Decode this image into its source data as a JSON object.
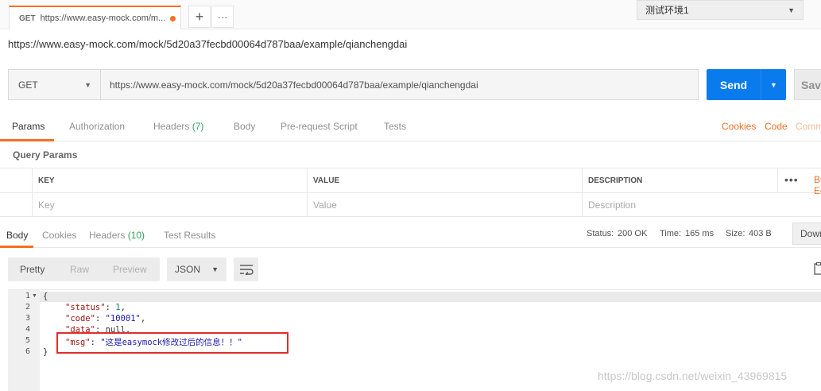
{
  "tab": {
    "method": "GET",
    "title": "https://www.easy-mock.com/m..."
  },
  "tab_buttons": {
    "add": "+",
    "more": "···"
  },
  "environment": {
    "selected": "测试环境1"
  },
  "request": {
    "title_url": "https://www.easy-mock.com/mock/5d20a37fecbd00064d787baa/example/qianchengdai",
    "method": "GET",
    "url": "https://www.easy-mock.com/mock/5d20a37fecbd00064d787baa/example/qianchengdai",
    "send_label": "Send",
    "save_label": "Save"
  },
  "request_tabs": {
    "params": "Params",
    "authorization": "Authorization",
    "headers": "Headers",
    "headers_count": "(7)",
    "body": "Body",
    "prerequest": "Pre-request Script",
    "tests": "Tests",
    "cookies": "Cookies",
    "code": "Code",
    "comments": "Comments"
  },
  "query_params": {
    "title": "Query Params",
    "columns": {
      "key": "KEY",
      "value": "VALUE",
      "description": "DESCRIPTION"
    },
    "placeholders": {
      "key": "Key",
      "value": "Value",
      "description": "Description"
    },
    "more": "•••",
    "bulk_edit": "Bulk Edit"
  },
  "response_tabs": {
    "body": "Body",
    "cookies": "Cookies",
    "headers": "Headers",
    "headers_count": "(10)",
    "test_results": "Test Results"
  },
  "response_status": {
    "status_label": "Status:",
    "status_value": "200 OK",
    "time_label": "Time:",
    "time_value": "165 ms",
    "size_label": "Size:",
    "size_value": "403 B",
    "download": "Download"
  },
  "format": {
    "pretty": "Pretty",
    "raw": "Raw",
    "preview": "Preview",
    "type": "JSON"
  },
  "code_lines": {
    "l1": "{",
    "l2_key": "\"status\"",
    "l2_val": "1",
    "l3_key": "\"code\"",
    "l3_val": "\"10001\"",
    "l4_key": "\"data\"",
    "l4_val": "null",
    "l5_key": "\"msg\"",
    "l5_val": "\"这是easymock修改过后的信息！！\"",
    "l6": "}"
  },
  "line_numbers": [
    "1",
    "2",
    "3",
    "4",
    "5",
    "6"
  ],
  "watermark": "https://blog.csdn.net/weixin_43969815"
}
